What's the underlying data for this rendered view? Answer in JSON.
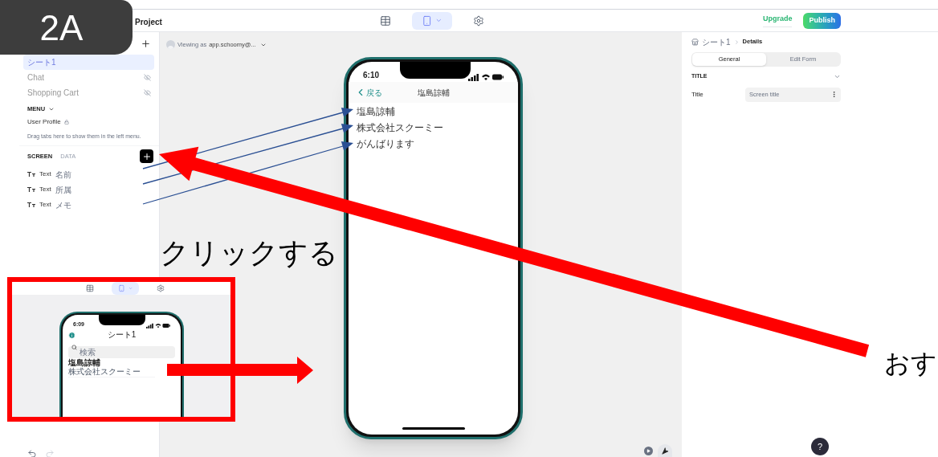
{
  "annotations": {
    "badge": "2A",
    "instruction": "クリックする",
    "side_label": "おす"
  },
  "top_bar": {
    "project": "Project",
    "view_tabs": [
      {
        "kind": "table",
        "selected": false
      },
      {
        "kind": "phone",
        "selected": true
      },
      {
        "kind": "settings",
        "selected": false
      }
    ],
    "upgrade": "Upgrade",
    "publish": "Publish"
  },
  "sidebar": {
    "tabs": [
      {
        "label": "シート1",
        "selected": true,
        "hidden": false
      },
      {
        "label": "Chat",
        "selected": false,
        "hidden": true
      },
      {
        "label": "Shopping Cart",
        "selected": false,
        "hidden": true
      }
    ],
    "menu": {
      "heading": "MENU",
      "items": [
        {
          "label": "User Profile",
          "locked": true
        }
      ],
      "hint": "Drag tabs here to show them in the left menu."
    },
    "panel_tabs": [
      {
        "label": "SCREEN",
        "selected": true
      },
      {
        "label": "DATA",
        "selected": false
      }
    ],
    "components": [
      {
        "type": "Text",
        "name": "名前"
      },
      {
        "type": "Text",
        "name": "所属"
      },
      {
        "type": "Text",
        "name": "メモ"
      }
    ]
  },
  "canvas": {
    "viewing_label": "Viewing as",
    "viewer": "app.schoomy@...",
    "phone": {
      "time": "6:10",
      "back": "戻る",
      "title": "塩島諒輔",
      "lines": [
        "塩島諒輔",
        "株式会社スクーミー",
        "がんばります"
      ]
    }
  },
  "inset": {
    "time": "6:09",
    "title": "シート1",
    "search_placeholder": "検索",
    "item": {
      "title": "塩島諒輔",
      "subtitle": "株式会社スクーミー"
    }
  },
  "details": {
    "breadcrumb": [
      "シート1",
      "Details"
    ],
    "tabs": [
      {
        "label": "General",
        "selected": true
      },
      {
        "label": "Edit Form",
        "selected": false
      }
    ],
    "section": "TITLE",
    "fields": [
      {
        "label": "Title",
        "placeholder": "Screen title"
      }
    ]
  },
  "help": "?"
}
